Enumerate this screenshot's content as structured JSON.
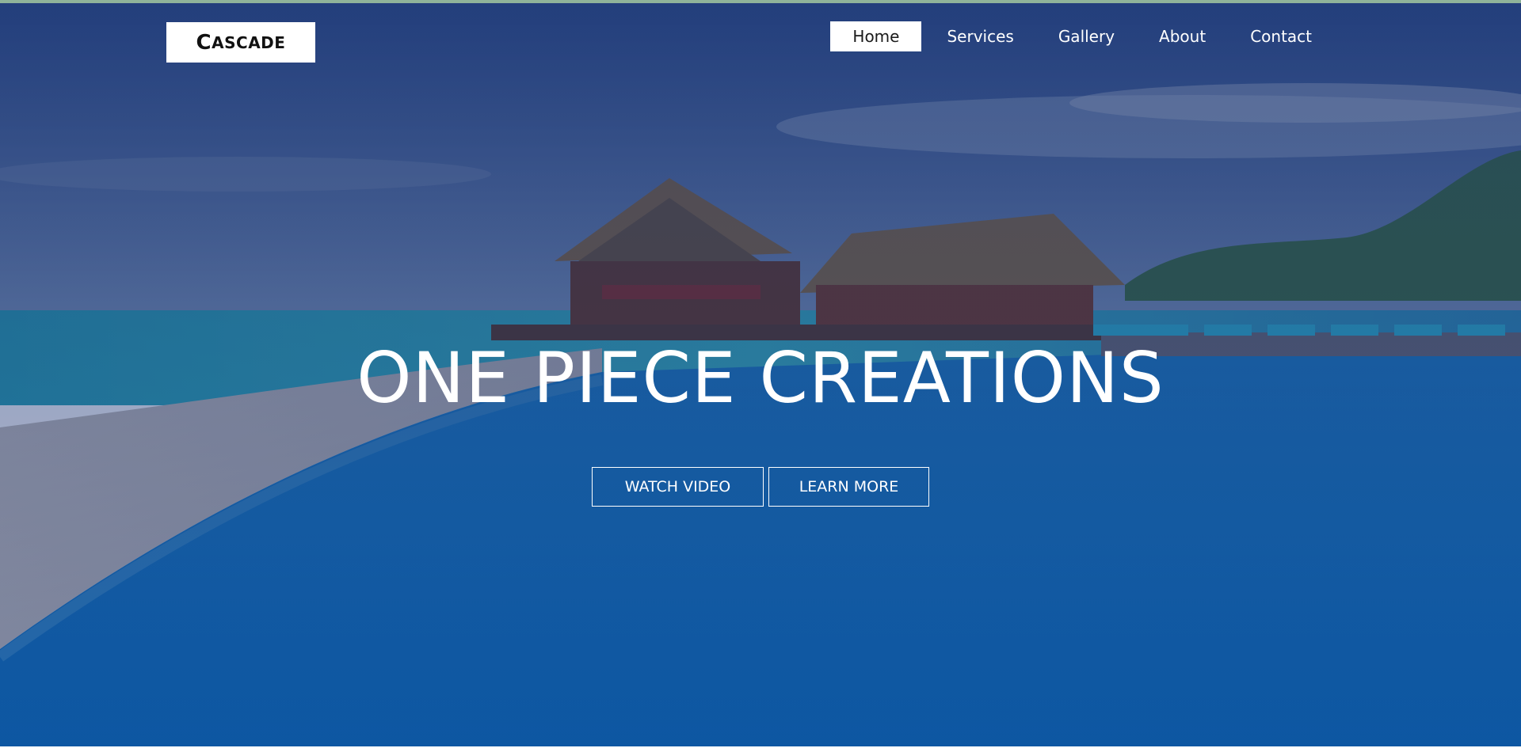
{
  "brand": {
    "logo_first": "C",
    "logo_rest": "ASCADE"
  },
  "nav": {
    "items": [
      {
        "label": "Home",
        "active": true
      },
      {
        "label": "Services",
        "active": false
      },
      {
        "label": "Gallery",
        "active": false
      },
      {
        "label": "About",
        "active": false
      },
      {
        "label": "Contact",
        "active": false
      }
    ]
  },
  "hero": {
    "headline": "ONE PIECE CREATIONS",
    "buttons": {
      "watch_video": "WATCH VIDEO",
      "learn_more": "LEARN MORE"
    }
  },
  "colors": {
    "overlay": "#1b3a78",
    "pool": "#1577c6",
    "sky": "#3b5f96",
    "accent_line": "#8fb39a"
  }
}
